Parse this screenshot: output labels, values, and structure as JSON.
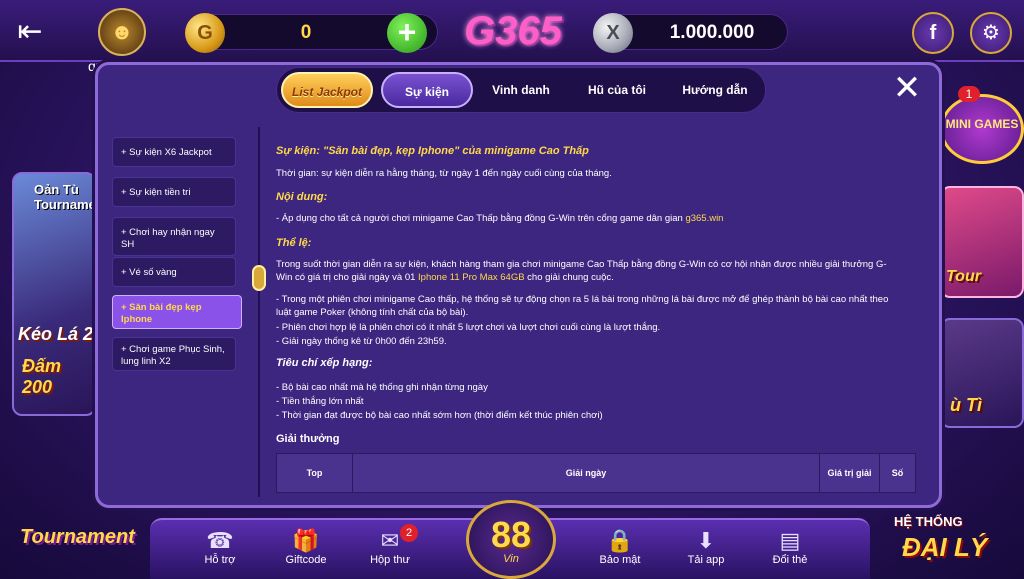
{
  "header": {
    "username": "qu",
    "gold_balance": "0",
    "silver_balance": "1.000.000",
    "logo_text": "G365",
    "gold_coin_symbol": "G",
    "silver_coin_symbol": "X"
  },
  "left_promo": {
    "top_text": "Oản Tù Tournament",
    "line1": "Kéo Lá 2",
    "line2": "Đấm 200"
  },
  "right_promo": {
    "mini_games": "MINI GAMES",
    "mini_badge": "1",
    "tour_label": "Tour",
    "ti_label": "ù Tì"
  },
  "tabs": {
    "jackpot": "List Jackpot",
    "events": "Sự kiện",
    "honor": "Vinh danh",
    "my_pot": "Hũ của tôi",
    "guide": "Hướng dẫn"
  },
  "menu": [
    "+ Sự kiện X6 Jackpot",
    "+ Sự kiện tiền tri",
    "+ Chơi hay nhận ngay SH",
    "+ Vé số vàng",
    "+ Săn bài đẹp kẹp Iphone",
    "+ Chơi game Phục Sinh, lung linh X2"
  ],
  "content": {
    "title": "Sự kiện: \"Săn bài đẹp, kẹp Iphone\" của minigame Cao Thấp",
    "time": "Thời gian: sự kiện diễn ra hằng tháng, từ ngày 1 đến ngày cuối cùng của tháng.",
    "h_content": "Nội dung:",
    "content_line_pre": "- Áp dụng cho tất cả người chơi minigame Cao Thấp bằng đồng G-Win trên cổng game dân gian ",
    "content_link": "g365.win",
    "h_rules": "Thể lệ:",
    "rules_p1_pre": "Trong suốt thời gian diễn ra sự kiện, khách hàng tham gia chơi minigame Cao Thấp bằng đồng G-Win có cơ hội nhận được nhiều giải thưởng G-Win có giá trị cho giải ngày và 01 ",
    "rules_p1_hl": "Iphone 11 Pro Max 64GB",
    "rules_p1_post": " cho giải chung cuộc.",
    "rules_p2": "- Trong một phiên chơi minigame Cao thấp, hệ thống sẽ tự động chọn ra 5 lá bài trong những lá bài được mở để ghép thành bộ bài cao nhất theo luật game Poker (không tính chất của bộ bài).",
    "rules_p3": "- Phiên chơi hợp lệ là phiên chơi có ít nhất 5 lượt chơi và lượt chơi cuối cùng là lượt thắng.",
    "rules_p4": "- Giải ngày thống kê từ 0h00 đến 23h59.",
    "h_criteria": "Tiêu chí xếp hạng:",
    "crit1": "- Bộ bài cao nhất mà hệ thống ghi nhận từng ngày",
    "crit2": "- Tiền thắng lớn nhất",
    "crit3": "- Thời gian đạt được bộ bài cao nhất sớm hơn (thời điểm kết thúc phiên chơi)",
    "h_prizes": "Giải thưởng",
    "table_headers": [
      "Top",
      "Giải ngày",
      "Giá trị giải",
      "Số"
    ]
  },
  "bottom_nav": {
    "support": "Hỗ trợ",
    "giftcode": "Giftcode",
    "inbox": "Hộp thư",
    "inbox_badge": "2",
    "center_number": "88",
    "center_sub": "Vin",
    "security": "Bảo mật",
    "download": "Tải app",
    "card_exchange": "Đổi thẻ"
  },
  "corner": {
    "tournament": "Tournament",
    "agent_line1": "HỆ THỐNG",
    "agent_line2": "ĐẠI LÝ"
  }
}
